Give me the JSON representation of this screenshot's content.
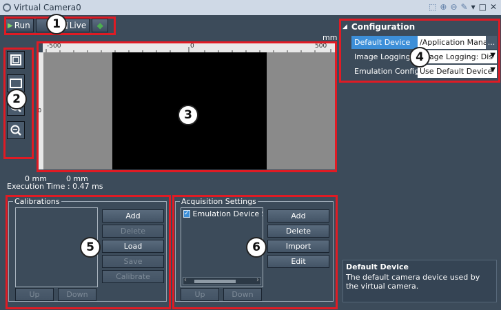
{
  "window": {
    "title": "Virtual Camera0"
  },
  "toolbar": {
    "run_label": "Run",
    "live_label": "Live"
  },
  "viewer": {
    "unit_label": "mm",
    "ruler_ticks": [
      "-500",
      "0",
      "500"
    ],
    "ruler_side_ticks": [
      "0"
    ],
    "coord_x": "0 mm",
    "coord_y": "0 mm",
    "execution_time": "Execution Time : 0.47 ms"
  },
  "calibrations": {
    "title": "Calibrations",
    "buttons": [
      "Add",
      "Delete",
      "Load",
      "Save",
      "Calibrate"
    ],
    "up_label": "Up",
    "down_label": "Down"
  },
  "acquisition": {
    "title": "Acquisition Settings",
    "items": [
      {
        "label": "Emulation Device S",
        "checked": true
      }
    ],
    "buttons": [
      "Add",
      "Delete",
      "Import",
      "Edit"
    ],
    "up_label": "Up",
    "down_label": "Down"
  },
  "configuration": {
    "header": "Configuration",
    "rows": [
      {
        "name": "Default Device",
        "value": "/Application Mana",
        "selected": true
      },
      {
        "name": "Image Logging",
        "value": "Image Logging: Dis"
      },
      {
        "name": "Emulation Config...",
        "value": "Use Default Device"
      }
    ],
    "ellipsis": "..."
  },
  "description": {
    "title": "Default Device",
    "text": "The default camera device used by the virtual camera."
  },
  "callouts": [
    "1",
    "2",
    "3",
    "4",
    "5",
    "6"
  ],
  "colors": {
    "highlight_red": "#e01b24",
    "accent_blue": "#3d8fd8",
    "background": "#3c4b5a"
  }
}
